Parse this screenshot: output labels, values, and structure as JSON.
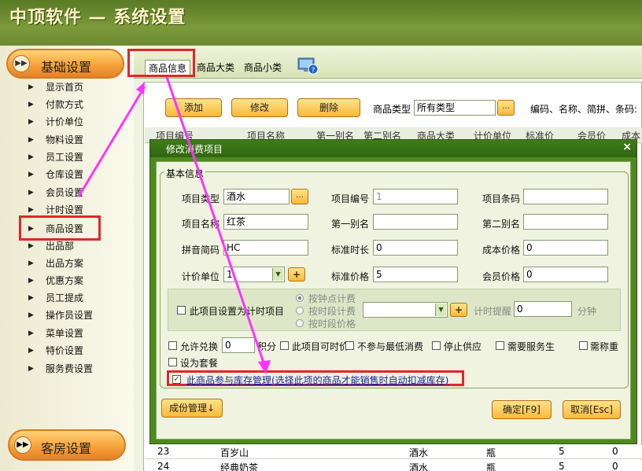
{
  "window": {
    "title": "中顶软件 — 系统设置"
  },
  "nav": {
    "section_title": "基础设置",
    "items": [
      "显示首页",
      "付款方式",
      "计价单位",
      "物料设置",
      "员工设置",
      "仓库设置",
      "会员设置",
      "计时设置",
      "商品设置",
      "出品部",
      "出品方案",
      "优惠方案",
      "员工提成",
      "操作员设置",
      "菜单设置",
      "特价设置",
      "服务费设置"
    ],
    "bottom_section": "客房设置"
  },
  "tabs": [
    "商品信息",
    "商品大类",
    "商品小类"
  ],
  "toolbar": {
    "add": "添加",
    "edit": "修改",
    "delete": "删除",
    "type_label": "商品类型",
    "type_value": "所有类型",
    "ellipsis": "...",
    "search_label": "编码、名称、简拼、条码:"
  },
  "grid": {
    "headers": [
      "项目编号",
      "项目名称",
      "第一别名",
      "第二别名",
      "商品大类",
      "计价单位",
      "标准价",
      "会员价",
      "成本"
    ],
    "rows": [
      {
        "no": "23",
        "name": "百岁山",
        "category": "酒水",
        "unit": "瓶",
        "price": "5",
        "member": "0"
      },
      {
        "no": "24",
        "name": "经典奶茶",
        "category": "酒水",
        "unit": "瓶",
        "price": "5",
        "member": "0"
      }
    ]
  },
  "dialog": {
    "title": "修改消费项目",
    "close": "×",
    "group_label": "基本信息",
    "fields": {
      "type_label": "项目类型",
      "type_value": "酒水",
      "code_label": "项目编号",
      "code_value": "1",
      "barcode_label": "项目条码",
      "barcode_value": "",
      "name_label": "项目名称",
      "name_value": "红茶",
      "alias1_label": "第一别名",
      "alias1_value": "",
      "alias2_label": "第二别名",
      "alias2_value": "",
      "pinyin_label": "拼音简码",
      "pinyin_value": "HC",
      "stdtime_label": "标准时长",
      "stdtime_value": "0",
      "cost_label": "成本价格",
      "cost_value": "0",
      "unit_label": "计价单位",
      "unit_value": "1",
      "stdprice_label": "标准价格",
      "stdprice_value": "5",
      "member_label": "会员价格",
      "member_value": "0"
    },
    "timing": {
      "checkbox_label": "此项目设置为计时项目",
      "radio_1": "按钟点计费",
      "radio_2": "按时段计费",
      "radio_3": "按时段价格",
      "remind_label": "计时提醒",
      "remind_value": "0",
      "remind_unit": "分钟"
    },
    "options": {
      "exchange_label": "允许兑换",
      "exchange_value": "0",
      "exchange_unit": "积分",
      "price_anytime": "此项目可时价",
      "no_min": "不参与最低消费",
      "stop_supply": "停止供应",
      "need_service": "需要服务生",
      "need_weigh": "需称重",
      "set_meal": "设为套餐"
    },
    "stock_label": "此商品参与库存管理(选择此项的商品才能销售时自动扣减库存)",
    "buttons": {
      "component": "成份管理↓",
      "ok": "确定[F9]",
      "cancel": "取消[Esc]"
    }
  }
}
